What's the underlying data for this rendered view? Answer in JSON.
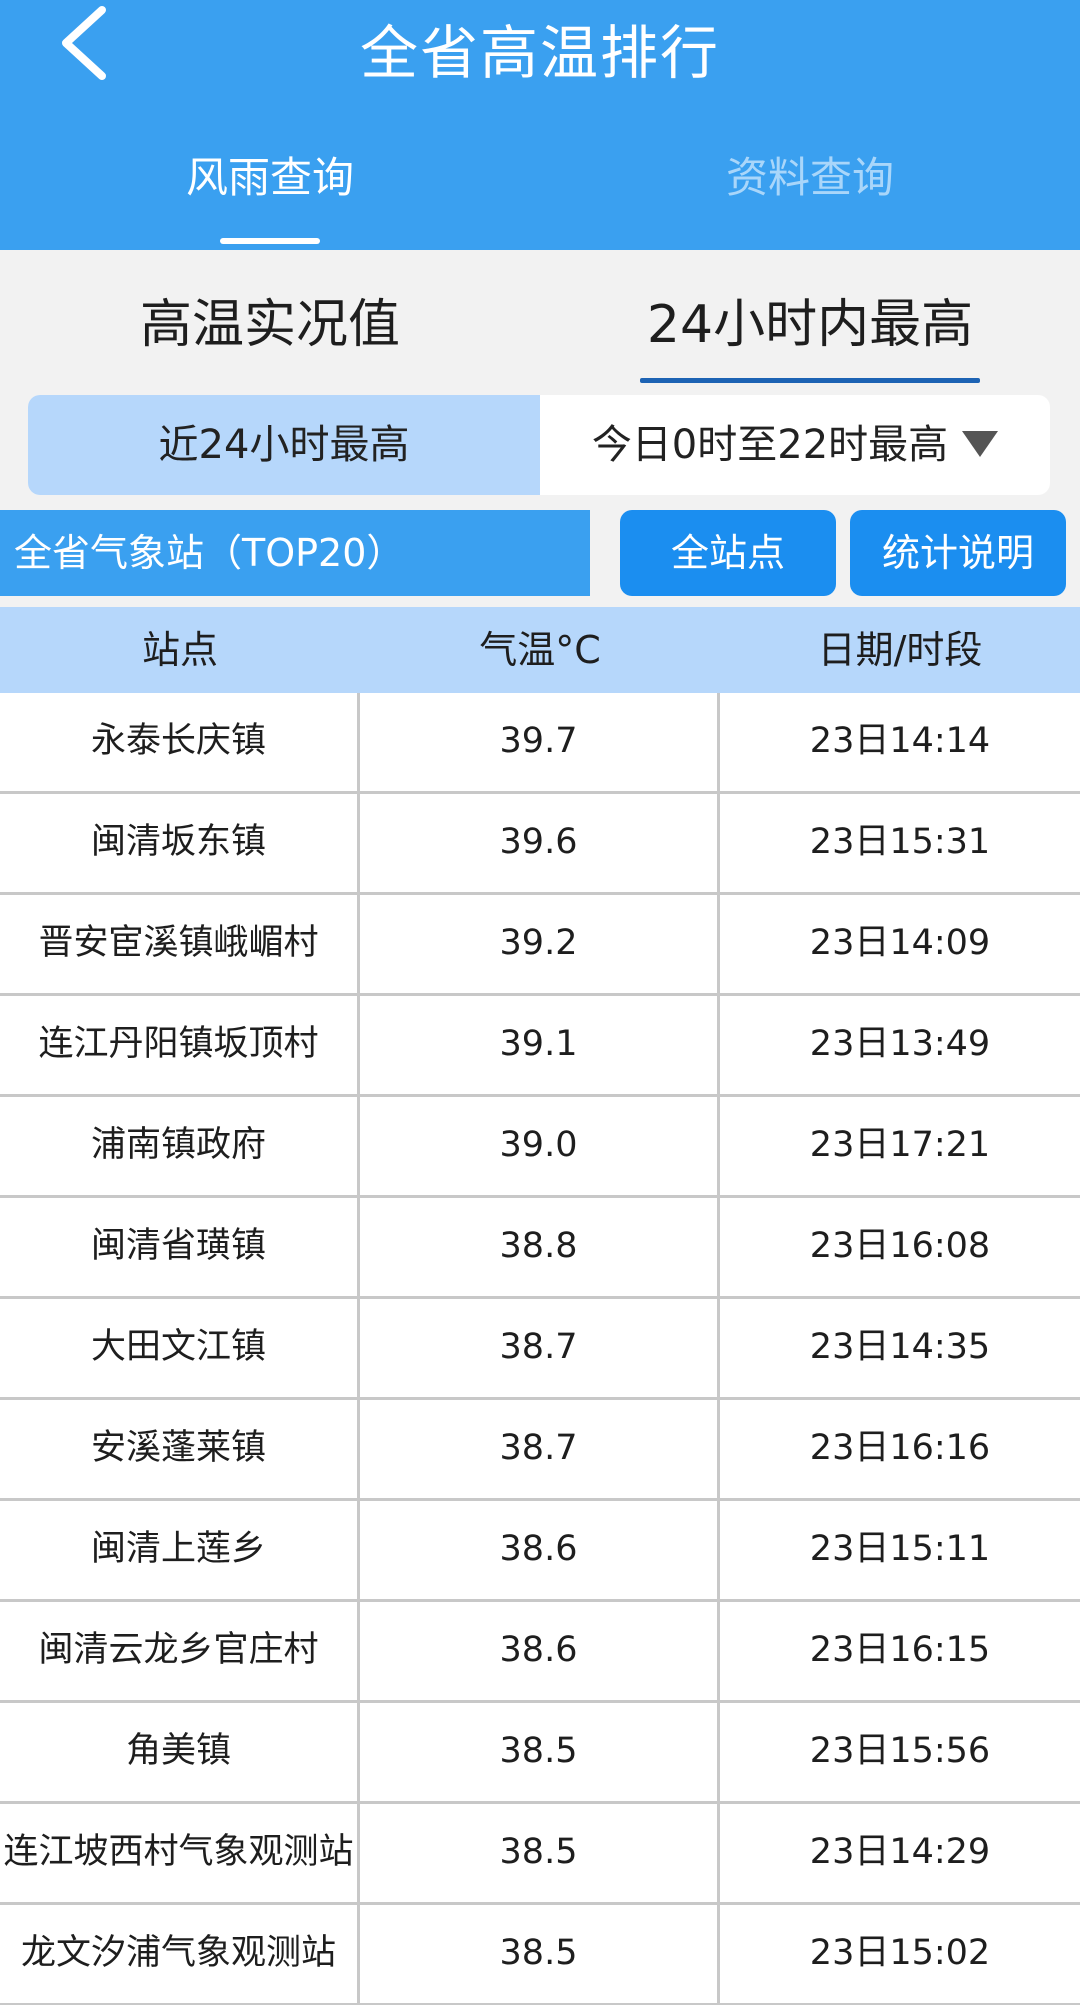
{
  "header": {
    "title": "全省高温排行",
    "tabs": [
      {
        "label": "风雨查询",
        "active": true
      },
      {
        "label": "资料查询",
        "active": false
      }
    ]
  },
  "subtabs": [
    {
      "label": "高温实况值",
      "active": false
    },
    {
      "label": "24小时内最高",
      "active": true
    }
  ],
  "range": {
    "left_label": "近24小时最高",
    "right_label": "今日0时至22时最高"
  },
  "scope": {
    "label": "全省气象站（TOP20）",
    "all_stations_button": "全站点",
    "stats_button": "统计说明"
  },
  "table": {
    "columns": [
      "站点",
      "气温°C",
      "日期/时段"
    ],
    "rows": [
      {
        "station": "永泰长庆镇",
        "temp": "39.7",
        "time": "23日14:14"
      },
      {
        "station": "闽清坂东镇",
        "temp": "39.6",
        "time": "23日15:31"
      },
      {
        "station": "晋安宦溪镇峨嵋村",
        "temp": "39.2",
        "time": "23日14:09"
      },
      {
        "station": "连江丹阳镇坂顶村",
        "temp": "39.1",
        "time": "23日13:49"
      },
      {
        "station": "浦南镇政府",
        "temp": "39.0",
        "time": "23日17:21"
      },
      {
        "station": "闽清省璜镇",
        "temp": "38.8",
        "time": "23日16:08"
      },
      {
        "station": "大田文江镇",
        "temp": "38.7",
        "time": "23日14:35"
      },
      {
        "station": "安溪蓬莱镇",
        "temp": "38.7",
        "time": "23日16:16"
      },
      {
        "station": "闽清上莲乡",
        "temp": "38.6",
        "time": "23日15:11"
      },
      {
        "station": "闽清云龙乡官庄村",
        "temp": "38.6",
        "time": "23日16:15"
      },
      {
        "station": "角美镇",
        "temp": "38.5",
        "time": "23日15:56"
      },
      {
        "station": "连江坡西村气象观测站",
        "temp": "38.5",
        "time": "23日14:29"
      },
      {
        "station": "龙文汐浦气象观测站",
        "temp": "38.5",
        "time": "23日15:02"
      }
    ]
  },
  "colors": {
    "header_bg": "#3aa0f0",
    "button_bg": "#1b8ef0",
    "light_blue": "#b6d7fb"
  }
}
